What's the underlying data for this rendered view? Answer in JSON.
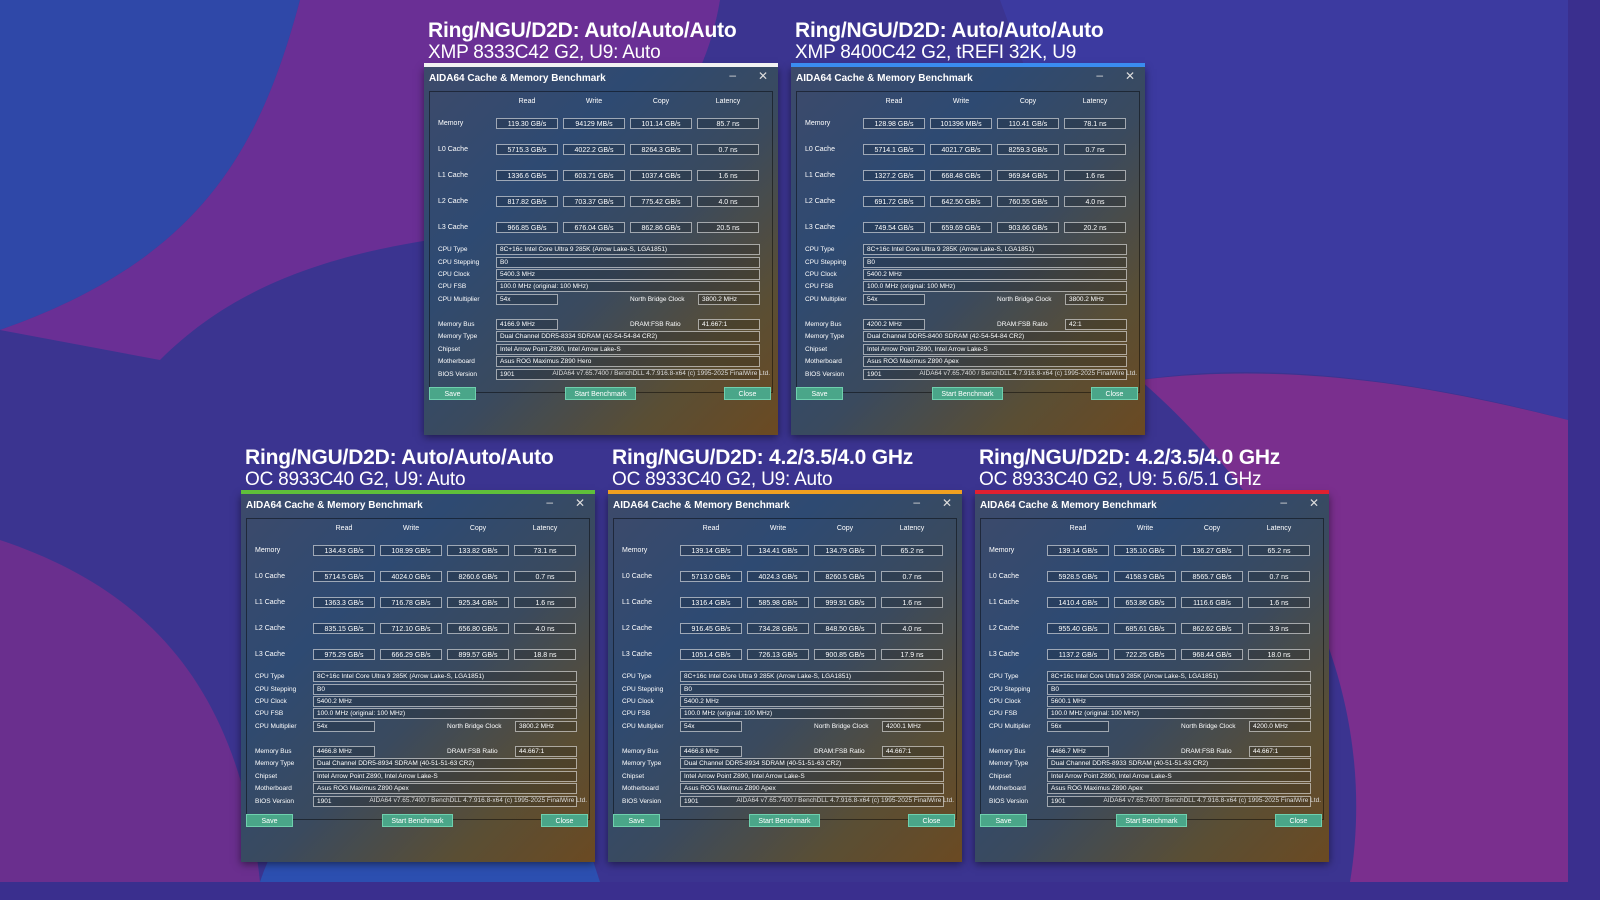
{
  "labels": {
    "window_title": "AIDA64 Cache & Memory Benchmark",
    "min_icon": "–",
    "close_icon": "✕",
    "col_read": "Read",
    "col_write": "Write",
    "col_copy": "Copy",
    "col_latency": "Latency",
    "row_memory": "Memory",
    "row_l0": "L0 Cache",
    "row_l1": "L1 Cache",
    "row_l2": "L2 Cache",
    "row_l3": "L3 Cache",
    "cpu_type": "CPU Type",
    "cpu_stepping": "CPU Stepping",
    "cpu_clock": "CPU Clock",
    "cpu_fsb": "CPU FSB",
    "cpu_multiplier": "CPU Multiplier",
    "nb_clock": "North Bridge Clock",
    "memory_bus": "Memory Bus",
    "dram_fsb": "DRAM:FSB Ratio",
    "memory_type": "Memory Type",
    "chipset": "Chipset",
    "motherboard": "Motherboard",
    "bios_version": "BIOS Version",
    "footer": "AIDA64 v7.65.7400 / BenchDLL 4.7.916.8-x64  (c) 1995-2025 FinalWire Ltd.",
    "save": "Save",
    "start_benchmark": "Start Benchmark",
    "close": "Close"
  },
  "panels": [
    {
      "title1": "Ring/NGU/D2D: Auto/Auto/Auto",
      "title2": "XMP 8333C42 G2, U9: Auto",
      "accent": "#f2f2f2",
      "results": [
        [
          "119.30 GB/s",
          "94129 MB/s",
          "101.14 GB/s",
          "85.7 ns"
        ],
        [
          "5715.3 GB/s",
          "4022.2 GB/s",
          "8264.3 GB/s",
          "0.7 ns"
        ],
        [
          "1336.6 GB/s",
          "603.71 GB/s",
          "1037.4 GB/s",
          "1.6 ns"
        ],
        [
          "817.82 GB/s",
          "703.37 GB/s",
          "775.42 GB/s",
          "4.0 ns"
        ],
        [
          "966.85 GB/s",
          "676.04 GB/s",
          "862.86 GB/s",
          "20.5 ns"
        ]
      ],
      "cpu_type": "8C+16c Intel Core Ultra 9 285K  (Arrow Lake-S, LGA1851)",
      "cpu_stepping": "B0",
      "cpu_clock": "5400.3 MHz",
      "cpu_fsb": "100.0 MHz  (original: 100 MHz)",
      "cpu_multiplier": "54x",
      "nb_clock": "3800.2 MHz",
      "memory_bus": "4166.9 MHz",
      "dram_fsb": "41.667:1",
      "memory_type": "Dual Channel DDR5-8334 SDRAM  (42-54-54-84 CR2)",
      "chipset": "Intel Arrow Point Z890, Intel Arrow Lake-S",
      "motherboard": "Asus ROG Maximus Z890 Hero",
      "bios_version": "1901"
    },
    {
      "title1": "Ring/NGU/D2D: Auto/Auto/Auto",
      "title2": "XMP 8400C42 G2, tREFI 32K, U9",
      "accent": "#3a8cf0",
      "results": [
        [
          "128.98 GB/s",
          "101396 MB/s",
          "110.41 GB/s",
          "78.1 ns"
        ],
        [
          "5714.1 GB/s",
          "4021.7 GB/s",
          "8259.3 GB/s",
          "0.7 ns"
        ],
        [
          "1327.2 GB/s",
          "668.48 GB/s",
          "969.84 GB/s",
          "1.6 ns"
        ],
        [
          "691.72 GB/s",
          "642.50 GB/s",
          "760.55 GB/s",
          "4.0 ns"
        ],
        [
          "749.54 GB/s",
          "659.69 GB/s",
          "903.66 GB/s",
          "20.2 ns"
        ]
      ],
      "cpu_type": "8C+16c Intel Core Ultra 9 285K  (Arrow Lake-S, LGA1851)",
      "cpu_stepping": "B0",
      "cpu_clock": "5400.2 MHz",
      "cpu_fsb": "100.0 MHz  (original: 100 MHz)",
      "cpu_multiplier": "54x",
      "nb_clock": "3800.2 MHz",
      "memory_bus": "4200.2 MHz",
      "dram_fsb": "42:1",
      "memory_type": "Dual Channel DDR5-8400 SDRAM  (42-54-54-84 CR2)",
      "chipset": "Intel Arrow Point Z890, Intel Arrow Lake-S",
      "motherboard": "Asus ROG Maximus Z890 Apex",
      "bios_version": "1901"
    },
    {
      "title1": "Ring/NGU/D2D: Auto/Auto/Auto",
      "title2": "OC 8933C40 G2, U9: Auto",
      "accent": "#5fbf3a",
      "results": [
        [
          "134.43 GB/s",
          "108.99 GB/s",
          "133.82 GB/s",
          "73.1 ns"
        ],
        [
          "5714.5 GB/s",
          "4024.0 GB/s",
          "8260.6 GB/s",
          "0.7 ns"
        ],
        [
          "1363.3 GB/s",
          "716.78 GB/s",
          "925.34 GB/s",
          "1.6 ns"
        ],
        [
          "835.15 GB/s",
          "712.10 GB/s",
          "656.80 GB/s",
          "4.0 ns"
        ],
        [
          "975.29 GB/s",
          "666.29 GB/s",
          "899.57 GB/s",
          "18.8 ns"
        ]
      ],
      "cpu_type": "8C+16c Intel Core Ultra 9 285K  (Arrow Lake-S, LGA1851)",
      "cpu_stepping": "B0",
      "cpu_clock": "5400.2 MHz",
      "cpu_fsb": "100.0 MHz  (original: 100 MHz)",
      "cpu_multiplier": "54x",
      "nb_clock": "3800.2 MHz",
      "memory_bus": "4466.8 MHz",
      "dram_fsb": "44.667:1",
      "memory_type": "Dual Channel DDR5-8934 SDRAM  (40-51-51-63 CR2)",
      "chipset": "Intel Arrow Point Z890, Intel Arrow Lake-S",
      "motherboard": "Asus ROG Maximus Z890 Apex",
      "bios_version": "1901"
    },
    {
      "title1": "Ring/NGU/D2D: 4.2/3.5/4.0 GHz",
      "title2": "OC 8933C40 G2, U9: Auto",
      "accent": "#f0a020",
      "results": [
        [
          "139.14 GB/s",
          "134.41 GB/s",
          "134.79 GB/s",
          "65.2 ns"
        ],
        [
          "5713.0 GB/s",
          "4024.3 GB/s",
          "8260.5 GB/s",
          "0.7 ns"
        ],
        [
          "1316.4 GB/s",
          "585.98 GB/s",
          "999.91 GB/s",
          "1.6 ns"
        ],
        [
          "916.45 GB/s",
          "734.28 GB/s",
          "848.50 GB/s",
          "4.0 ns"
        ],
        [
          "1051.4 GB/s",
          "726.13 GB/s",
          "900.85 GB/s",
          "17.9 ns"
        ]
      ],
      "cpu_type": "8C+16c Intel Core Ultra 9 285K  (Arrow Lake-S, LGA1851)",
      "cpu_stepping": "B0",
      "cpu_clock": "5400.2 MHz",
      "cpu_fsb": "100.0 MHz  (original: 100 MHz)",
      "cpu_multiplier": "54x",
      "nb_clock": "4200.1 MHz",
      "memory_bus": "4466.8 MHz",
      "dram_fsb": "44.667:1",
      "memory_type": "Dual Channel DDR5-8934 SDRAM  (40-51-51-63 CR2)",
      "chipset": "Intel Arrow Point Z890, Intel Arrow Lake-S",
      "motherboard": "Asus ROG Maximus Z890 Apex",
      "bios_version": "1901"
    },
    {
      "title1": "Ring/NGU/D2D: 4.2/3.5/4.0 GHz",
      "title2": "OC 8933C40 G2, U9: 5.6/5.1 GHz",
      "accent": "#e02030",
      "results": [
        [
          "139.14 GB/s",
          "135.10 GB/s",
          "136.27 GB/s",
          "65.2 ns"
        ],
        [
          "5928.5 GB/s",
          "4158.9 GB/s",
          "8565.7 GB/s",
          "0.7 ns"
        ],
        [
          "1410.4 GB/s",
          "653.86 GB/s",
          "1116.6 GB/s",
          "1.6 ns"
        ],
        [
          "955.40 GB/s",
          "685.61 GB/s",
          "862.62 GB/s",
          "3.9 ns"
        ],
        [
          "1137.2 GB/s",
          "722.25 GB/s",
          "968.44 GB/s",
          "18.0 ns"
        ]
      ],
      "cpu_type": "8C+16c Intel Core Ultra 9 285K  (Arrow Lake-S, LGA1851)",
      "cpu_stepping": "B0",
      "cpu_clock": "5600.1 MHz",
      "cpu_fsb": "100.0 MHz  (original: 100 MHz)",
      "cpu_multiplier": "56x",
      "nb_clock": "4200.0 MHz",
      "memory_bus": "4466.7 MHz",
      "dram_fsb": "44.667:1",
      "memory_type": "Dual Channel DDR5-8933 SDRAM  (40-51-51-63 CR2)",
      "chipset": "Intel Arrow Point Z890, Intel Arrow Lake-S",
      "motherboard": "Asus ROG Maximus Z890 Apex",
      "bios_version": "1901"
    }
  ]
}
